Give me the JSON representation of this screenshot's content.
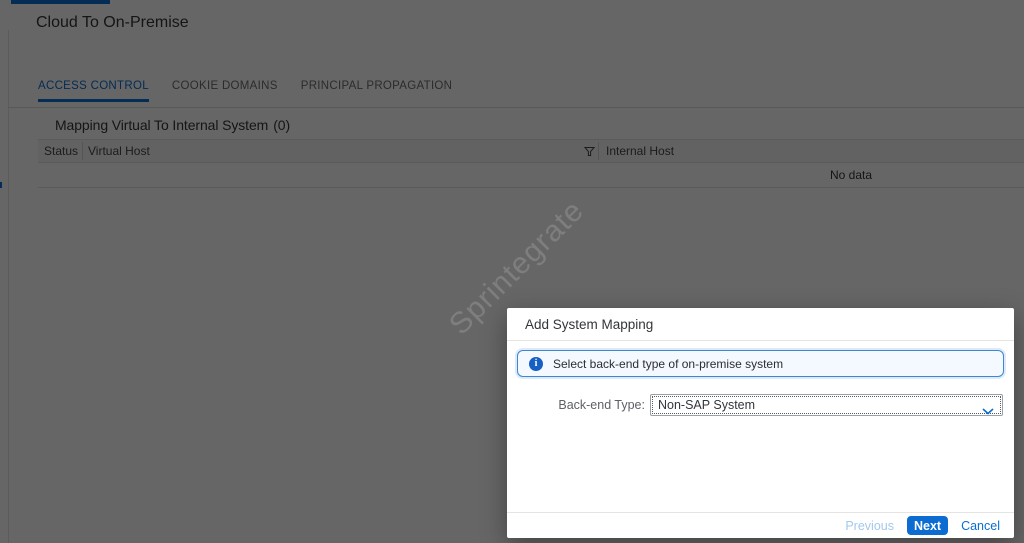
{
  "page": {
    "title": "Cloud To On-Premise",
    "tabs": [
      {
        "label": "ACCESS CONTROL",
        "active": true
      },
      {
        "label": "COOKIE DOMAINS",
        "active": false
      },
      {
        "label": "PRINCIPAL PROPAGATION",
        "active": false
      }
    ],
    "section": {
      "heading": "Mapping Virtual To Internal System",
      "count": "(0)",
      "table": {
        "columns": [
          "Status",
          "Virtual Host",
          "Internal Host"
        ],
        "empty_message": "No data"
      }
    },
    "watermark": "Sprintegrate"
  },
  "dialog": {
    "title": "Add System Mapping",
    "info_message": "Select back-end type of on-premise system",
    "field": {
      "label": "Back-end Type:",
      "value": "Non-SAP System"
    },
    "buttons": {
      "previous": "Previous",
      "next": "Next",
      "cancel": "Cancel"
    }
  },
  "icons": {
    "info_glyph": "i"
  },
  "colors": {
    "accent": "#0a6ed1",
    "tab_active": "#0a6ed1",
    "info_border": "#3f86d2",
    "info_background": "#f4f9ff",
    "primary_button": "#0c6cd1",
    "backdrop": "rgba(0,0,0,0.60)"
  }
}
